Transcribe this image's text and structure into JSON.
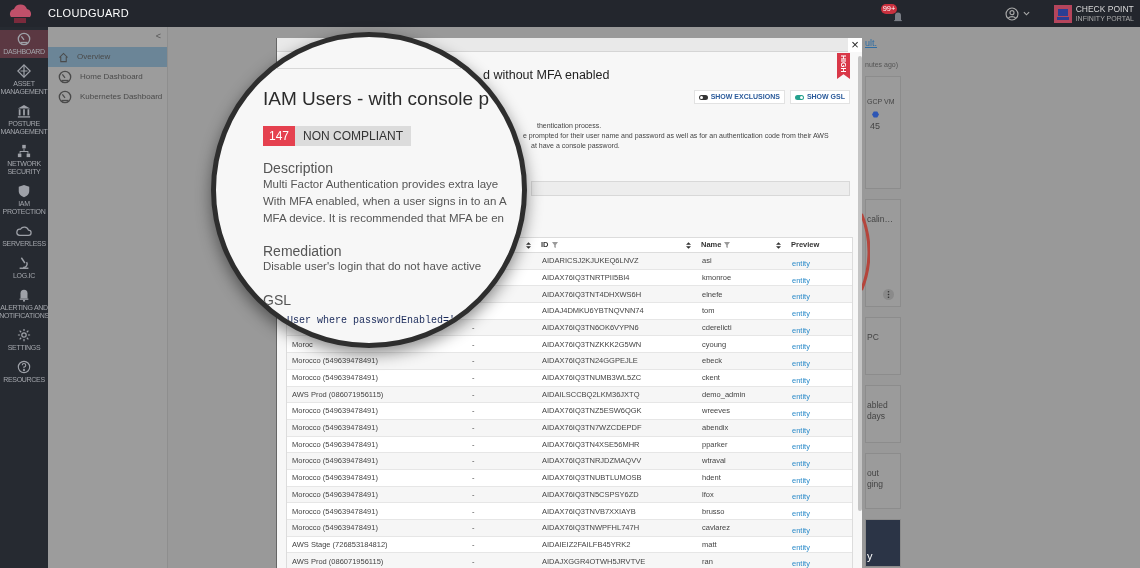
{
  "topbar": {
    "brand": "CLOUDGUARD",
    "notification_badge": "99+",
    "portal_title": "CHECK POINT",
    "portal_subtitle": "INFINITY PORTAL"
  },
  "rail": [
    {
      "kind": "gauge",
      "label": "DASHBOARD",
      "selected": true
    },
    {
      "kind": "diamond",
      "label": "ASSET MANAGEMENT",
      "selected": false
    },
    {
      "kind": "bank",
      "label": "POSTURE MANAGEMENT",
      "selected": false
    },
    {
      "kind": "network",
      "label": "NETWORK SECURITY",
      "selected": false
    },
    {
      "kind": "shield",
      "label": "IAM PROTECTION",
      "selected": false
    },
    {
      "kind": "cloud",
      "label": "SERVERLESS",
      "selected": false
    },
    {
      "kind": "microscope",
      "label": "LOG.IC",
      "selected": false
    },
    {
      "kind": "bell",
      "label": "ALERTING AND NOTIFICATIONS",
      "selected": false
    },
    {
      "kind": "gear",
      "label": "SETTINGS",
      "selected": false
    },
    {
      "kind": "help",
      "label": "RESOURCES",
      "selected": false
    }
  ],
  "nav": {
    "collapse": "<",
    "items": [
      {
        "kind": "home",
        "label": "Overview",
        "selected": true
      },
      {
        "kind": "gauge",
        "label": "Home Dashboard",
        "selected": false
      },
      {
        "kind": "gauge",
        "label": "Kubernetes Dashboard",
        "selected": false
      }
    ]
  },
  "background": {
    "link": "ult.",
    "updated": "nutes ago)",
    "gcp_label": "GCP VM",
    "gcp_count": "45",
    "card_texts": [
      [
        "calin…"
      ],
      [
        "PC"
      ],
      [
        "abled",
        "days"
      ],
      [
        "out",
        "ging"
      ],
      [
        "y"
      ]
    ]
  },
  "modal": {
    "close": "×",
    "title": "d without MFA enabled",
    "severity": "HIGH",
    "toggles": [
      {
        "label": "SHOW EXCLUSIONS",
        "on": false
      },
      {
        "label": "SHOW GSL",
        "on": true
      }
    ],
    "description_lines": [
      "thentication process.",
      "e prompted for their user name and password as well as for an authentication code from their AWS",
      "at have a console password."
    ],
    "table": {
      "columns": [
        {
          "sort": true
        },
        {
          "label": "ID",
          "sort": true,
          "filter": true
        },
        {
          "label": "Name",
          "sort": true,
          "filter": true
        },
        {
          "label": "Preview",
          "sort": false,
          "filter": false
        }
      ],
      "rows": [
        {
          "id": "AIDARICSJ2KJUKEQ6LNVZ",
          "name": "asi",
          "preview": "entity"
        },
        {
          "id": "AIDAX76IQ3TNRTPII5BI4",
          "name": "kmonroe",
          "preview": "entity"
        },
        {
          "id": "AIDAX76IQ3TNT4DHXWS6H",
          "name": "elnefe",
          "preview": "entity"
        },
        {
          "id": "AIDAJ4DMKU6YBTNQVNN74",
          "name": "tom",
          "preview": "entity"
        },
        {
          "column_2": "-",
          "id": "AIDAX76IQ3TN6OK6VYPN6",
          "name": "cderelicti",
          "preview": "entity"
        },
        {
          "column_1": "Moroc",
          "column_2": "-",
          "id": "AIDAX76IQ3TNZKKK2G5WN",
          "name": "cyoung",
          "preview": "entity"
        },
        {
          "column_1": "Morocco (549639478491)",
          "column_2": "-",
          "id": "AIDAX76IQ3TN24GGPEJLE",
          "name": "ebeck",
          "preview": "entity"
        },
        {
          "column_1": "Morocco (549639478491)",
          "column_2": "-",
          "id": "AIDAX76IQ3TNUMB3WL5ZC",
          "name": "ckent",
          "preview": "entity"
        },
        {
          "column_1": "AWS Prod (086071956115)",
          "column_2": "-",
          "id": "AIDAILSCCBQ2LKM36JXTQ",
          "name": "demo_admin",
          "preview": "entity"
        },
        {
          "column_1": "Morocco (549639478491)",
          "column_2": "-",
          "id": "AIDAX76IQ3TNZ5ESW6QGK",
          "name": "wreeves",
          "preview": "entity"
        },
        {
          "column_1": "Morocco (549639478491)",
          "column_2": "-",
          "id": "AIDAX76IQ3TN7WZCDEPDF",
          "name": "abendix",
          "preview": "entity"
        },
        {
          "column_1": "Morocco (549639478491)",
          "column_2": "-",
          "id": "AIDAX76IQ3TN4XSE56MHR",
          "name": "pparker",
          "preview": "entity"
        },
        {
          "column_1": "Morocco (549639478491)",
          "column_2": "-",
          "id": "AIDAX76IQ3TNRJDZMAQVV",
          "name": "wtraval",
          "preview": "entity"
        },
        {
          "column_1": "Morocco (549639478491)",
          "column_2": "-",
          "id": "AIDAX76IQ3TNUBTLUMOSB",
          "name": "hdent",
          "preview": "entity"
        },
        {
          "column_1": "Morocco (549639478491)",
          "column_2": "-",
          "id": "AIDAX76IQ3TN5CSPSY6ZD",
          "name": "lfox",
          "preview": "entity"
        },
        {
          "column_1": "Morocco (549639478491)",
          "column_2": "-",
          "id": "AIDAX76IQ3TNVB7XXIAYB",
          "name": "brusso",
          "preview": "entity"
        },
        {
          "column_1": "Morocco (549639478491)",
          "column_2": "-",
          "id": "AIDAX76IQ3TNWPFHL747H",
          "name": "cavlarez",
          "preview": "entity"
        },
        {
          "column_1": "AWS Stage (726853184812)",
          "column_2": "-",
          "id": "AIDAIEIZ2FAILFB45YRK2",
          "name": "matt",
          "preview": "entity"
        },
        {
          "column_1": "AWS Prod (086071956115)",
          "column_2": "-",
          "id": "AIDAJXGGR4OTWH5JRVTVE",
          "name": "ran",
          "preview": "entity"
        }
      ]
    }
  },
  "magnifier": {
    "title": "IAM Users - with console p",
    "count": "147",
    "status": "NON COMPLIANT",
    "description_heading": "Description",
    "description_lines": [
      "Multi Factor Authentication provides extra laye",
      "With MFA enabled, when a user signs in to an A",
      "MFA device. It is recommended that MFA be en"
    ],
    "remediation_heading": "Remediation",
    "remediation_text": "Disable user's login that do not have active",
    "gsl_heading": "GSL",
    "gsl_code": "User where passwordEnabled='"
  }
}
